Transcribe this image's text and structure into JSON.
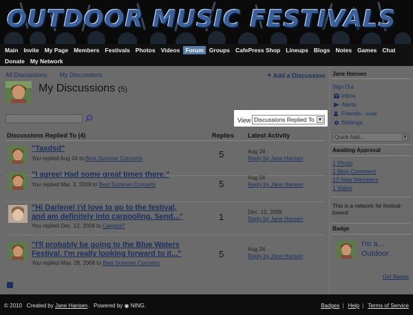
{
  "header": {
    "site_title": "OUTDOOR MUSIC FESTIVALS"
  },
  "nav": {
    "row1": [
      "Main",
      "Invite",
      "My Page",
      "Members",
      "Festivals",
      "Photos",
      "Videos",
      "Forum",
      "Groups",
      "CafePress Shop",
      "Lineups",
      "Blogs",
      "Notes",
      "Games",
      "Chat"
    ],
    "row2": [
      "Donate",
      "My Network"
    ],
    "active": "Forum"
  },
  "tabs": {
    "all": "All Discussions",
    "mine": "My Discussions"
  },
  "add_discussion": "Add a Discussion",
  "page": {
    "title": "My Discussions",
    "count": "(5)"
  },
  "search": {
    "placeholder": "Search by This Author"
  },
  "view": {
    "label": "View",
    "selected": "Discussions Replied To"
  },
  "table": {
    "header_topic": "Discussions Replied To (4)",
    "header_replies": "Replies",
    "header_activity": "Latest Activity",
    "rows": [
      {
        "title": "\"Tasdsd\"",
        "title2": "",
        "meta_prefix": "You replied Aug 24 to",
        "meta_link": "Best Summer Concerts",
        "replies": "5",
        "date": "Aug 24",
        "by": "Reply by Jane Hansen"
      },
      {
        "title": "\"I agree! Had some great times there.\"",
        "title2": "",
        "meta_prefix": "You replied Mar. 3, 2009 to",
        "meta_link": "Best Summer Concerts",
        "replies": "5",
        "date": "Aug 24",
        "by": "Reply by Jane Hansen"
      },
      {
        "title": "\"Hi Darlene! I'd love to go to the festival,",
        "title2": "and am definitely into carpooling. Send...\"",
        "meta_prefix": "You replied Dec. 12, 2008 to",
        "meta_link": "Carpool?",
        "replies": "1",
        "date": "Dec. 12, 2008",
        "by": "Reply by Jane Hansen"
      },
      {
        "title": "\"I'll probably be going to the Blue Waters",
        "title2": "Festival. I'm really looking forward to it...\"",
        "meta_prefix": "You replied May. 28, 2008 to",
        "meta_link": "Best Summer Concerts",
        "replies": "5",
        "date": "Aug 24",
        "by": "Reply by Jane Hansen"
      }
    ]
  },
  "sidebar": {
    "user_name": "Jane Hansen",
    "sign_out": "Sign Out",
    "inbox": "Inbox",
    "alerts": "Alerts",
    "friends": "Friends",
    "invite": "- Invite",
    "settings": "Settings",
    "quick_add": "Quick Add...",
    "awaiting_approval": "Awaiting Approval",
    "approvals": [
      "1 Photo",
      "1 Blog Comment",
      "13 New Members",
      "1 Video"
    ],
    "network_text": "This is a network for festival-lovers!",
    "badge_head": "Badge",
    "badge_text1": "I'm a...",
    "badge_text2": "Outdoor",
    "get_badge": "Get Badge"
  },
  "footer": {
    "copyright": "© 2010",
    "created_by": "Created by",
    "author": "Jane Hansen",
    "powered_by": "Powered by",
    "ning": "NING.",
    "links": [
      "Badges",
      "Help",
      "Terms of Service"
    ]
  },
  "colors": {
    "link": "#1a2f60",
    "nav_active": "#5a7fa8",
    "panel": "#6b6b6b",
    "title_blue": "#3a5f9a"
  }
}
